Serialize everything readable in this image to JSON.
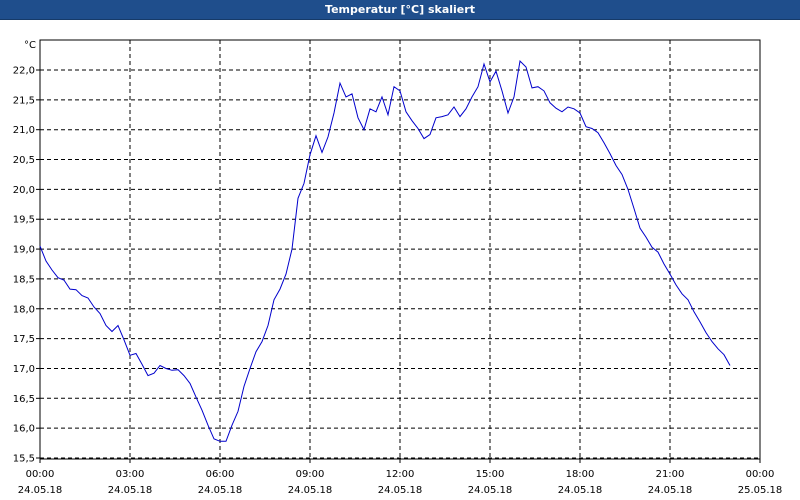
{
  "window": {
    "title": "Temperatur [°C] skaliert"
  },
  "chart_data": {
    "type": "line",
    "title": "Temperatur [°C] skaliert",
    "ylabel": "°C",
    "xlabel": "",
    "ylim": [
      15.5,
      22.0
    ],
    "y_ticks": [
      "22,0",
      "21,5",
      "21,0",
      "20,5",
      "20,0",
      "19,5",
      "19,0",
      "18,5",
      "18,0",
      "17,5",
      "17,0",
      "16,5",
      "16,0",
      "15,5"
    ],
    "x_ticks": [
      {
        "time": "00:00",
        "date": "24.05.18"
      },
      {
        "time": "03:00",
        "date": "24.05.18"
      },
      {
        "time": "06:00",
        "date": "24.05.18"
      },
      {
        "time": "09:00",
        "date": "24.05.18"
      },
      {
        "time": "12:00",
        "date": "24.05.18"
      },
      {
        "time": "15:00",
        "date": "24.05.18"
      },
      {
        "time": "18:00",
        "date": "24.05.18"
      },
      {
        "time": "21:00",
        "date": "24.05.18"
      },
      {
        "time": "00:00",
        "date": "25.05.18"
      }
    ],
    "grid": true,
    "line_color": "#0000cc",
    "series": [
      {
        "x_hours": [
          0,
          0.2,
          0.4,
          0.6,
          0.8,
          1.0,
          1.2,
          1.4,
          1.6,
          1.8,
          2.0,
          2.2,
          2.4,
          2.6,
          2.8,
          3.0,
          3.2,
          3.4,
          3.6,
          3.8,
          4.0,
          4.2,
          4.4,
          4.6,
          4.8,
          5.0,
          5.2,
          5.4,
          5.6,
          5.8,
          6.0,
          6.2,
          6.4,
          6.6,
          6.8,
          7.0,
          7.2,
          7.4,
          7.6,
          7.8,
          8.0,
          8.2,
          8.4,
          8.6,
          8.8,
          9.0,
          9.2,
          9.4,
          9.6,
          9.8,
          10.0,
          10.2,
          10.4,
          10.6,
          10.8,
          11.0,
          11.2,
          11.4,
          11.6,
          11.8,
          12.0,
          12.2,
          12.4,
          12.6,
          12.8,
          13.0,
          13.2,
          13.4,
          13.6,
          13.8,
          14.0,
          14.2,
          14.4,
          14.6,
          14.8,
          15.0,
          15.2,
          15.4,
          15.6,
          15.8,
          16.0,
          16.2,
          16.4,
          16.6,
          16.8,
          17.0,
          17.2,
          17.4,
          17.6,
          17.8,
          18.0,
          18.2,
          18.4,
          18.6,
          18.8,
          19.0,
          19.2,
          19.4,
          19.6,
          19.8,
          20.0,
          20.2,
          20.4,
          20.6,
          20.8,
          21.0,
          21.2,
          21.4,
          21.6,
          21.8,
          22.0,
          22.2,
          22.4,
          22.6,
          22.8,
          23.0,
          23.2,
          23.4,
          23.6,
          23.8
        ],
        "values": [
          19.05,
          18.8,
          18.65,
          18.52,
          18.48,
          18.33,
          18.32,
          18.22,
          18.18,
          18.03,
          17.92,
          17.72,
          17.62,
          17.72,
          17.48,
          17.22,
          17.25,
          17.07,
          16.88,
          16.92,
          17.05,
          17.0,
          16.97,
          16.98,
          16.88,
          16.75,
          16.52,
          16.3,
          16.05,
          15.82,
          15.78,
          15.78,
          16.05,
          16.28,
          16.7,
          17.0,
          17.28,
          17.45,
          17.72,
          18.15,
          18.33,
          18.58,
          19.0,
          19.85,
          20.1,
          20.58,
          20.9,
          20.62,
          20.88,
          21.28,
          21.78,
          21.55,
          21.6,
          21.2,
          21.0,
          21.35,
          21.3,
          21.55,
          21.25,
          21.72,
          21.65,
          21.3,
          21.15,
          21.02,
          20.85,
          20.92,
          21.2,
          21.22,
          21.25,
          21.38,
          21.22,
          21.35,
          21.55,
          21.72,
          22.1,
          21.8,
          21.98,
          21.65,
          21.28,
          21.55,
          22.15,
          22.05,
          21.7,
          21.72,
          21.65,
          21.45,
          21.36,
          21.3,
          21.38,
          21.35,
          21.28,
          21.05,
          21.02,
          20.95,
          20.78,
          20.6,
          20.4,
          20.25,
          20.0,
          19.68,
          19.35,
          19.2,
          19.03,
          18.95,
          18.75,
          18.58,
          18.4,
          18.25,
          18.15,
          17.95,
          17.78,
          17.6,
          17.45,
          17.33,
          17.23,
          17.05
        ]
      }
    ]
  }
}
